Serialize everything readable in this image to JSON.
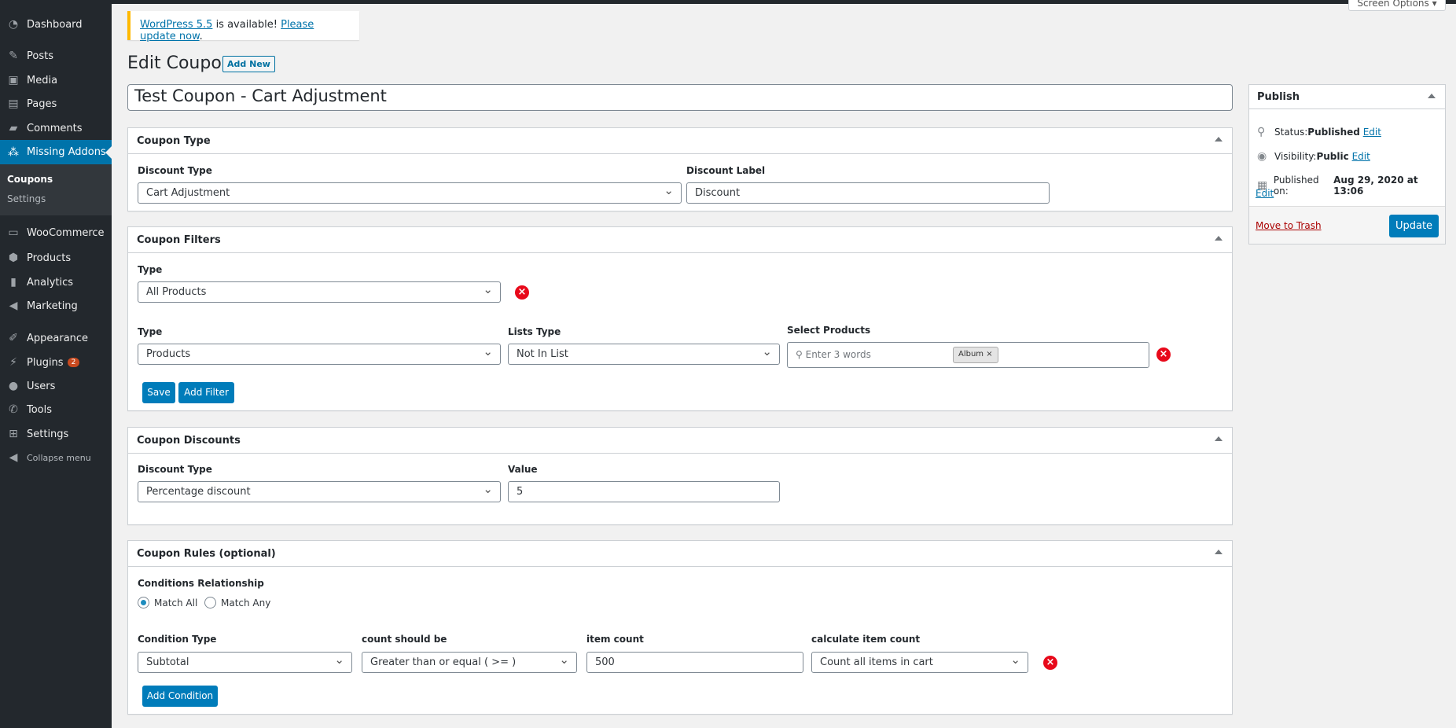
{
  "sidebar": {
    "items": [
      {
        "label": "Dashboard",
        "icon": "dashboard-icon"
      },
      {
        "label": "Posts",
        "icon": "pin-icon"
      },
      {
        "label": "Media",
        "icon": "media-icon"
      },
      {
        "label": "Pages",
        "icon": "pages-icon"
      },
      {
        "label": "Comments",
        "icon": "comment-icon"
      },
      {
        "label": "Missing Addons",
        "icon": "addons-icon",
        "active": true
      },
      {
        "label": "WooCommerce",
        "icon": "woo-icon"
      },
      {
        "label": "Products",
        "icon": "box-icon"
      },
      {
        "label": "Analytics",
        "icon": "chart-icon"
      },
      {
        "label": "Marketing",
        "icon": "megaphone-icon"
      },
      {
        "label": "Appearance",
        "icon": "brush-icon"
      },
      {
        "label": "Plugins",
        "icon": "plug-icon",
        "badge": "2"
      },
      {
        "label": "Users",
        "icon": "user-icon"
      },
      {
        "label": "Tools",
        "icon": "wrench-icon"
      },
      {
        "label": "Settings",
        "icon": "settings-icon"
      },
      {
        "label": "Collapse menu",
        "icon": "collapse-icon"
      }
    ],
    "submenu": [
      "Coupons",
      "Settings"
    ]
  },
  "notice": {
    "version_link": "WordPress 5.5",
    "middle": " is available! ",
    "update_link": "Please update now",
    "end": "."
  },
  "screen_options": "Screen Options ▾",
  "page": {
    "title": "Edit Coupon",
    "add_new": "Add New",
    "coupon_title": "Test Coupon - Cart Adjustment"
  },
  "coupon_type": {
    "heading": "Coupon Type",
    "discount_type_label": "Discount Type",
    "discount_type": "Cart Adjustment",
    "discount_label_label": "Discount Label",
    "discount_label": "Discount"
  },
  "filters": {
    "heading": "Coupon Filters",
    "type_label": "Type",
    "type1": "All Products",
    "type2_label": "Type",
    "type2": "Products",
    "lists_type_label": "Lists Type",
    "lists_type": "Not In List",
    "select_products_label": "Select Products",
    "search_placeholder": "Enter 3 words",
    "tag": "Album",
    "save": "Save",
    "add_filter": "Add Filter"
  },
  "discounts": {
    "heading": "Coupon Discounts",
    "discount_type_label": "Discount Type",
    "discount_type": "Percentage discount",
    "value_label": "Value",
    "value": "5"
  },
  "rules": {
    "heading": "Coupon Rules (optional)",
    "relationship_label": "Conditions Relationship",
    "match_all": "Match All",
    "match_any": "Match Any",
    "selected": "Match All",
    "condition_type_label": "Condition Type",
    "condition_type": "Subtotal",
    "count_should_be_label": "count should be",
    "count_should_be": "Greater than or equal ( >= )",
    "item_count_label": "item count",
    "item_count": "500",
    "calculate_label": "calculate item count",
    "calculate": "Count all items in cart",
    "add_condition": "Add Condition"
  },
  "publish": {
    "heading": "Publish",
    "status_label": "Status: ",
    "status": "Published",
    "visibility_label": "Visibility: ",
    "visibility": "Public",
    "published_label": "Published on: ",
    "published": "Aug 29, 2020 at 13:06",
    "edit": "Edit",
    "trash": "Move to Trash",
    "update": "Update"
  },
  "colors": {
    "accent": "#0073aa",
    "button": "#007cba",
    "sidebar": "#23282d",
    "remove": "#e8091a",
    "notice": "#ffb900"
  }
}
